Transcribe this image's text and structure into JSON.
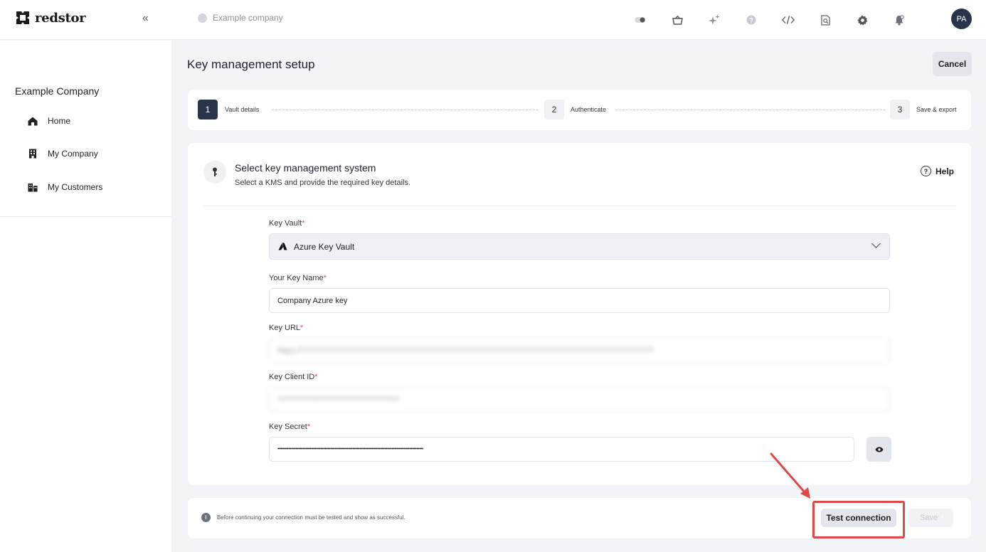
{
  "brand": {
    "name": "redstor"
  },
  "topbar": {
    "company": "Example company",
    "icons": [
      "toggle-icon",
      "basket-icon",
      "sparkle-icon",
      "help-icon",
      "code-icon",
      "search-doc-icon",
      "gear-icon",
      "bell-icon"
    ],
    "avatar_initials": "PA"
  },
  "sidebar": {
    "title": "Example Company",
    "items": [
      {
        "label": "Home",
        "icon": "home-icon"
      },
      {
        "label": "My Company",
        "icon": "building-icon"
      },
      {
        "label": "My Customers",
        "icon": "buildings-icon"
      }
    ]
  },
  "page": {
    "title": "Key management setup",
    "cancel_label": "Cancel"
  },
  "stepper": {
    "steps": [
      {
        "num": "1",
        "label": "Vault details",
        "active": true
      },
      {
        "num": "2",
        "label": "Authenticate",
        "active": false
      },
      {
        "num": "3",
        "label": "Save & export",
        "active": false
      }
    ]
  },
  "card": {
    "title": "Select key management system",
    "subtitle": "Select a KMS and provide the required key details.",
    "help_label": "Help"
  },
  "form": {
    "key_vault": {
      "label": "Key Vault",
      "value": "Azure Key Vault"
    },
    "key_name": {
      "label": "Your Key Name",
      "value": "Company Azure key"
    },
    "key_url": {
      "label": "Key URL",
      "value": "https://?????????????????????????????????????????????????????????????????????????????????"
    },
    "key_client_id": {
      "label": "Key Client ID",
      "value": "????????????????????????????"
    },
    "key_secret": {
      "label": "Key Secret",
      "value": "•••••••••••••••••••••••••••••••••••••••••••••••••••••••••••••••••••••••••••••••••••••••••••••••••••••••••"
    }
  },
  "footer": {
    "note": "Before continuing your connection must be tested and show as successful.",
    "test_label": "Test connection",
    "save_label": "Save"
  },
  "colors": {
    "accent": "#273449",
    "annotation": "#e04848"
  }
}
